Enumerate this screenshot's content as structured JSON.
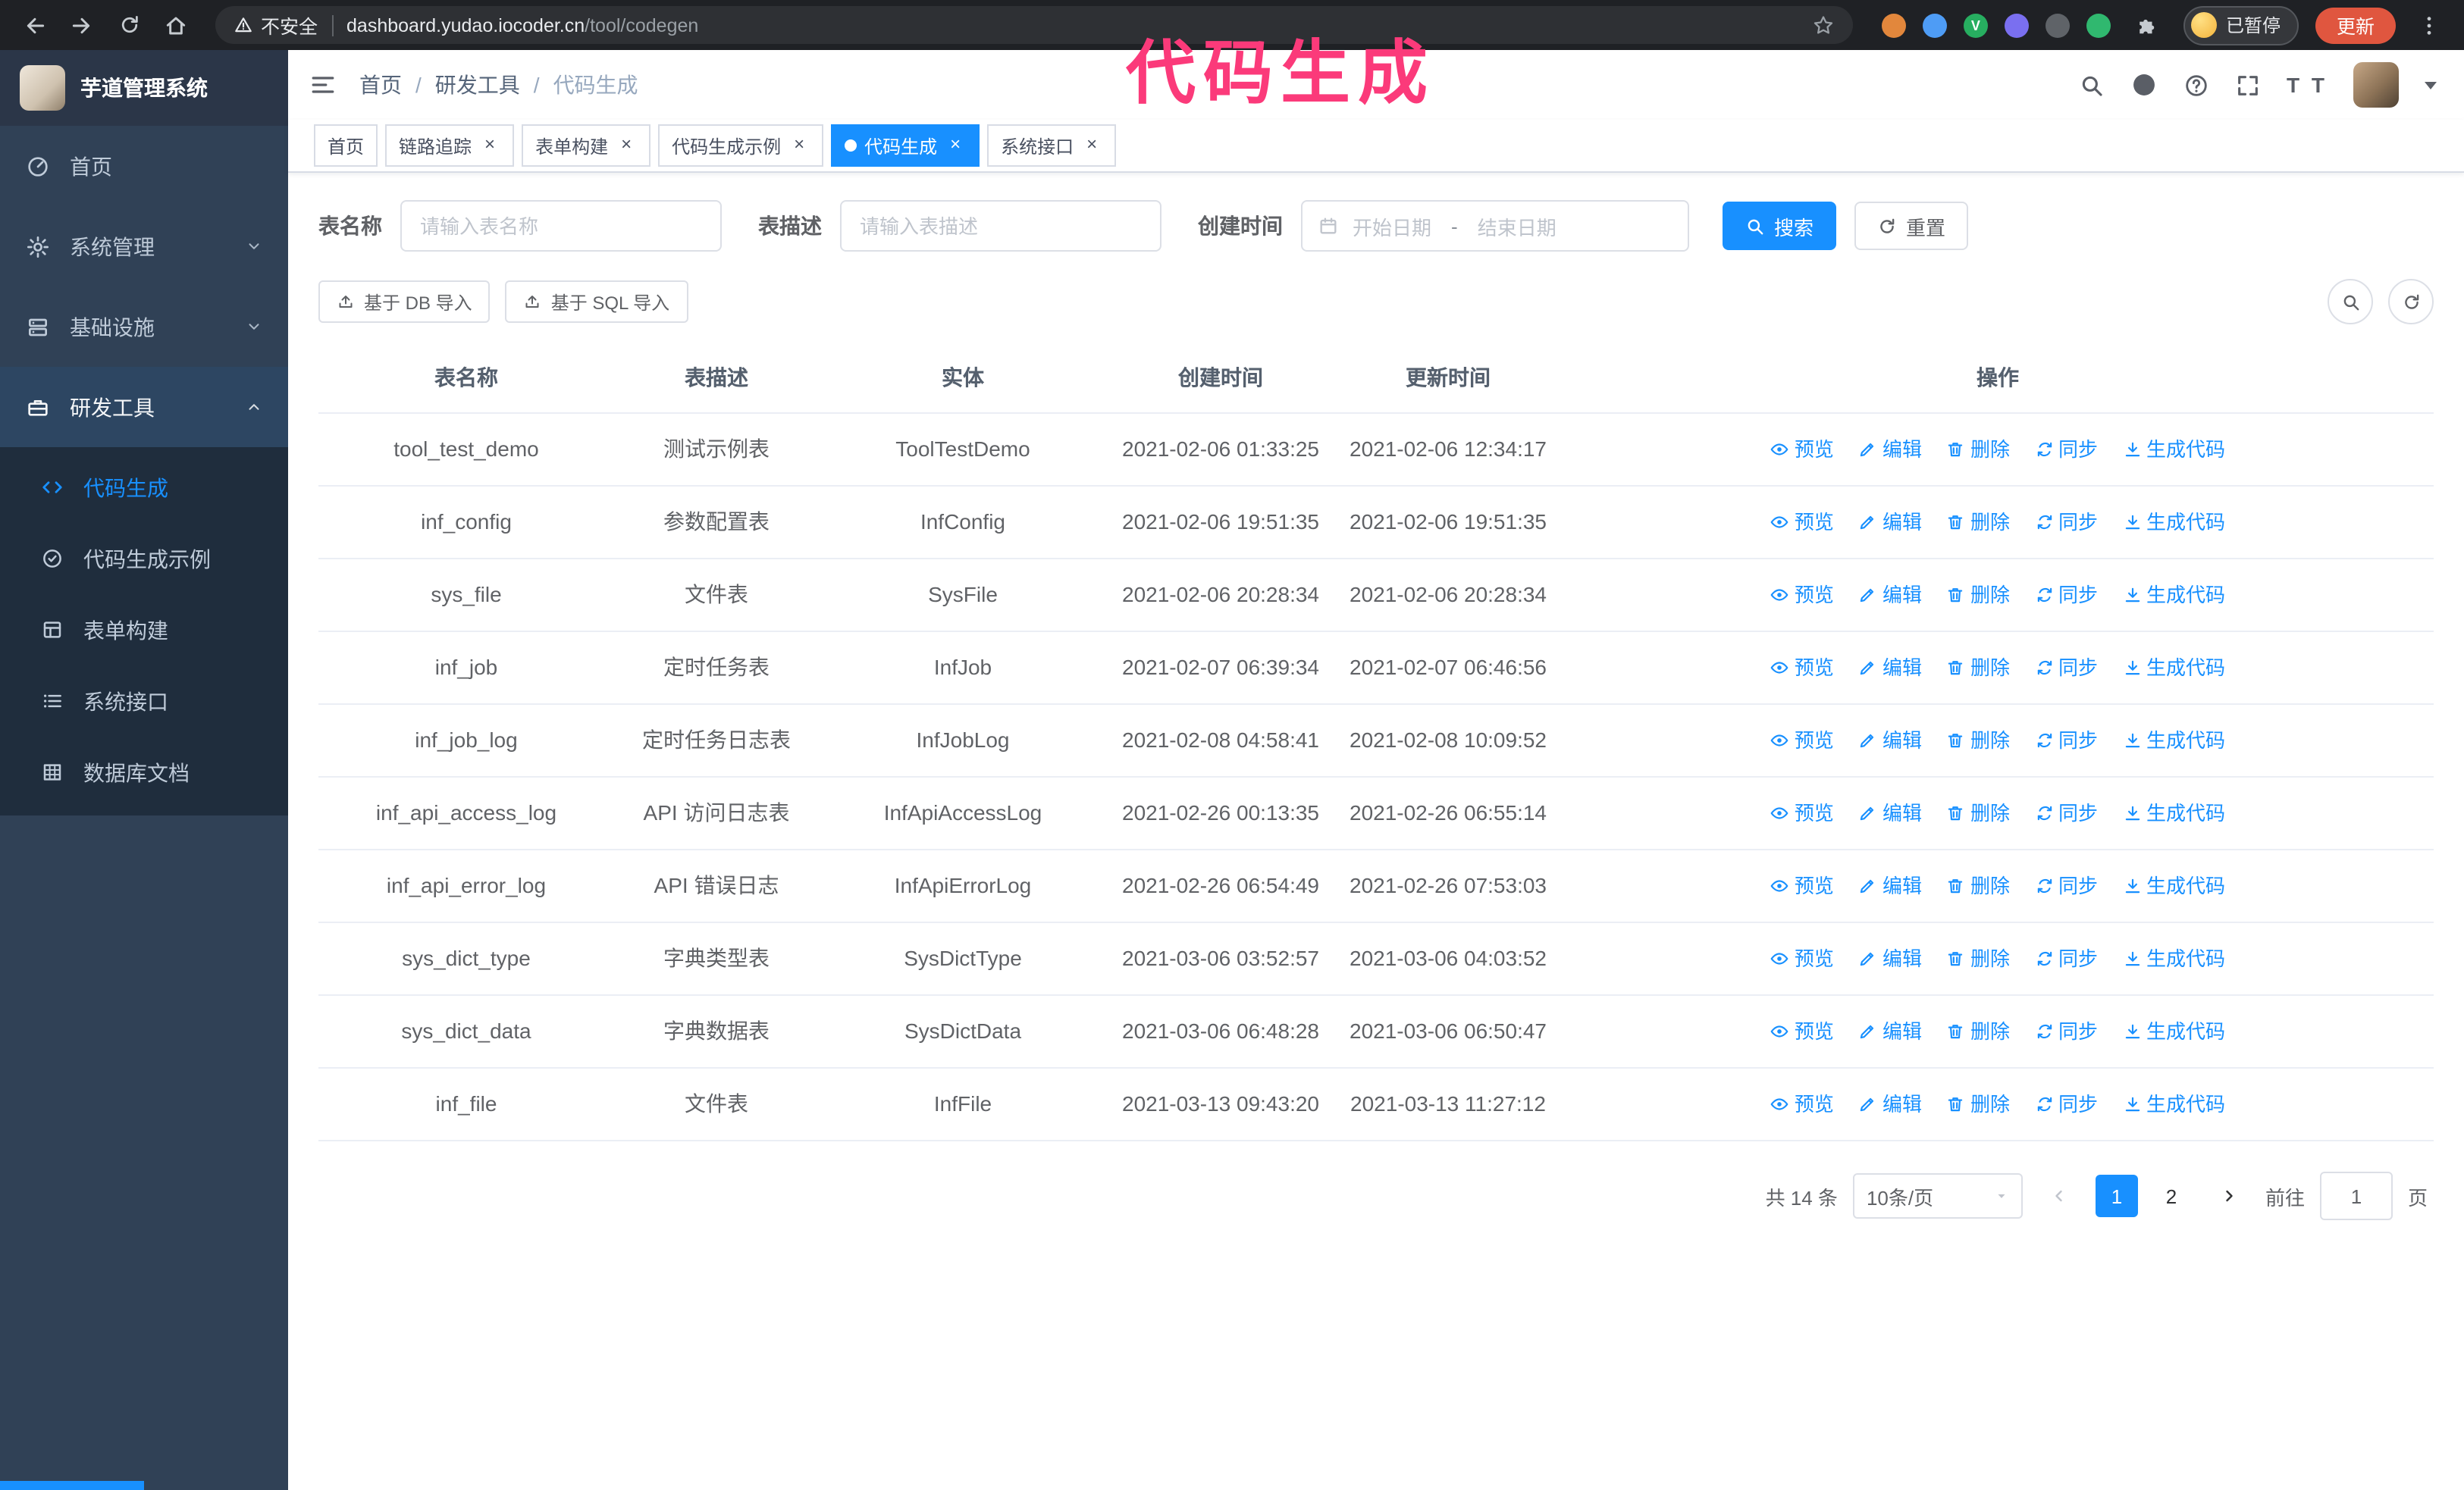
{
  "annotation": {
    "text": "代码生成",
    "color": "#fb3a7a"
  },
  "browser": {
    "security_warning": "不安全",
    "url_domain": "dashboard.yudao.iocoder.cn",
    "url_path": "/tool/codegen",
    "paused_badge": "已暂停",
    "update_button": "更新",
    "extensions": [
      {
        "name": "extension-icon-1",
        "color": "#e2873c",
        "letter": ""
      },
      {
        "name": "extension-icon-2",
        "color": "#4e9cf5",
        "letter": ""
      },
      {
        "name": "extension-icon-3",
        "color": "#27ae60",
        "letter": "V"
      },
      {
        "name": "extension-icon-4",
        "color": "#7a6ff0",
        "letter": ""
      },
      {
        "name": "extension-icon-5",
        "color": "#5f6368",
        "letter": ""
      },
      {
        "name": "extension-icon-6",
        "color": "#30b86f",
        "letter": ""
      }
    ]
  },
  "sidebar": {
    "logo_title": "芋道管理系统",
    "items": [
      {
        "key": "home",
        "icon": "i-gauge",
        "icon_name": "home-icon",
        "label": "首页"
      },
      {
        "key": "system",
        "icon": "i-gear",
        "icon_name": "system-icon",
        "label": "系统管理",
        "chevron": "down"
      },
      {
        "key": "infra",
        "icon": "i-monitor",
        "icon_name": "infra-icon",
        "label": "基础设施",
        "chevron": "down"
      },
      {
        "key": "devtools",
        "icon": "i-tools",
        "icon_name": "tools-icon",
        "label": "研发工具",
        "chevron": "up",
        "expanded": true
      }
    ],
    "submenu": [
      {
        "key": "codegen",
        "icon": "i-code",
        "icon_name": "code-icon",
        "label": "代码生成",
        "active": true
      },
      {
        "key": "codegen-example",
        "icon": "i-badge",
        "icon_name": "example-icon",
        "label": "代码生成示例"
      },
      {
        "key": "form-builder",
        "icon": "i-form",
        "icon_name": "form-icon",
        "label": "表单构建"
      },
      {
        "key": "api",
        "icon": "i-list",
        "icon_name": "api-icon",
        "label": "系统接口"
      },
      {
        "key": "db-doc",
        "icon": "i-grid",
        "icon_name": "database-icon",
        "label": "数据库文档"
      }
    ]
  },
  "header": {
    "breadcrumb": [
      "首页",
      "研发工具",
      "代码生成"
    ],
    "font_size_icon_text": "T T"
  },
  "tabs": [
    {
      "key": "home",
      "label": "首页",
      "closable": false,
      "active": false
    },
    {
      "key": "tracer",
      "label": "链路追踪",
      "closable": true,
      "active": false
    },
    {
      "key": "form-builder",
      "label": "表单构建",
      "closable": true,
      "active": false
    },
    {
      "key": "codegen-example",
      "label": "代码生成示例",
      "closable": true,
      "active": false
    },
    {
      "key": "codegen",
      "label": "代码生成",
      "closable": true,
      "active": true
    },
    {
      "key": "api",
      "label": "系统接口",
      "closable": true,
      "active": false
    }
  ],
  "filters": {
    "name_label": "表名称",
    "name_placeholder": "请输入表名称",
    "desc_label": "表描述",
    "desc_placeholder": "请输入表描述",
    "time_label": "创建时间",
    "start_placeholder": "开始日期",
    "range_separator": "-",
    "end_placeholder": "结束日期",
    "search_label": "搜索",
    "reset_label": "重置"
  },
  "toolbar": {
    "db_import": "基于 DB 导入",
    "sql_import": "基于 SQL 导入"
  },
  "table": {
    "columns": [
      "表名称",
      "表描述",
      "实体",
      "创建时间",
      "更新时间",
      "操作"
    ],
    "actions": [
      {
        "key": "preview",
        "icon": "i-eye",
        "icon_name": "eye-icon",
        "label": "预览"
      },
      {
        "key": "edit",
        "icon": "i-edit",
        "icon_name": "edit-icon",
        "label": "编辑"
      },
      {
        "key": "delete",
        "icon": "i-trash",
        "icon_name": "delete-icon",
        "label": "删除"
      },
      {
        "key": "sync",
        "icon": "i-sync",
        "icon_name": "sync-icon",
        "label": "同步"
      },
      {
        "key": "generate",
        "icon": "i-download",
        "icon_name": "download-icon",
        "label": "生成代码"
      }
    ],
    "rows": [
      {
        "name": "tool_test_demo",
        "description": "测试示例表",
        "entity": "ToolTestDemo",
        "created": "2021-02-06 01:33:25",
        "updated": "2021-02-06 12:34:17"
      },
      {
        "name": "inf_config",
        "description": "参数配置表",
        "entity": "InfConfig",
        "created": "2021-02-06 19:51:35",
        "updated": "2021-02-06 19:51:35"
      },
      {
        "name": "sys_file",
        "description": "文件表",
        "entity": "SysFile",
        "created": "2021-02-06 20:28:34",
        "updated": "2021-02-06 20:28:34"
      },
      {
        "name": "inf_job",
        "description": "定时任务表",
        "entity": "InfJob",
        "created": "2021-02-07 06:39:34",
        "updated": "2021-02-07 06:46:56"
      },
      {
        "name": "inf_job_log",
        "description": "定时任务日志表",
        "entity": "InfJobLog",
        "created": "2021-02-08 04:58:41",
        "updated": "2021-02-08 10:09:52"
      },
      {
        "name": "inf_api_access_log",
        "description": "API 访问日志表",
        "entity": "InfApiAccessLog",
        "created": "2021-02-26 00:13:35",
        "updated": "2021-02-26 06:55:14"
      },
      {
        "name": "inf_api_error_log",
        "description": "API 错误日志",
        "entity": "InfApiErrorLog",
        "created": "2021-02-26 06:54:49",
        "updated": "2021-02-26 07:53:03"
      },
      {
        "name": "sys_dict_type",
        "description": "字典类型表",
        "entity": "SysDictType",
        "created": "2021-03-06 03:52:57",
        "updated": "2021-03-06 04:03:52"
      },
      {
        "name": "sys_dict_data",
        "description": "字典数据表",
        "entity": "SysDictData",
        "created": "2021-03-06 06:48:28",
        "updated": "2021-03-06 06:50:47"
      },
      {
        "name": "inf_file",
        "description": "文件表",
        "entity": "InfFile",
        "created": "2021-03-13 09:43:20",
        "updated": "2021-03-13 11:27:12"
      }
    ]
  },
  "pagination": {
    "total": "共 14 条",
    "page_size": "10条/页",
    "pages": [
      "1",
      "2"
    ],
    "current": "1",
    "goto_label": "前往",
    "goto_value": "1",
    "page_unit": "页"
  },
  "ui": {
    "close_glyph": "×"
  },
  "colors": {
    "accent": "#1890ff",
    "sidebar_bg": "#304156",
    "submenu_bg": "#1f2d3d",
    "annotation": "#fb3a7a",
    "update_button": "#e0563f"
  }
}
